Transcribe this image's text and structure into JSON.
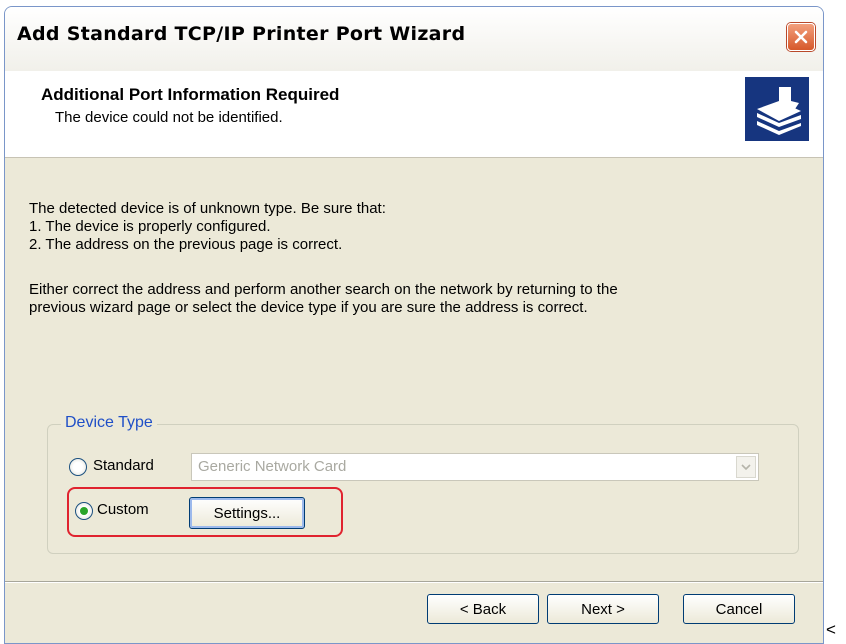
{
  "window": {
    "title": "Add Standard TCP/IP Printer Port Wizard"
  },
  "header": {
    "title": "Additional Port Information Required",
    "subtitle": "The device could not be identified."
  },
  "body": {
    "line1": "The detected device is of unknown type.  Be sure that:",
    "line2": "1. The device is properly configured.",
    "line3": "2.  The address on the previous page is correct.",
    "line4": "Either correct the address and perform another search on the network by returning to the",
    "line5": "previous wizard page or select the device type if you are sure the address is correct."
  },
  "device_type": {
    "legend": "Device Type",
    "standard_label": "Standard",
    "dropdown_value": "Generic Network Card",
    "custom_label": "Custom",
    "settings_label": "Settings...",
    "selected": "Custom"
  },
  "footer": {
    "back_label": "< Back",
    "next_label": "Next >",
    "cancel_label": "Cancel"
  },
  "stray_char": "<",
  "colors": {
    "highlight": "#e0232f",
    "legend": "#1f4fc7",
    "icon_bg": "#16357f"
  }
}
